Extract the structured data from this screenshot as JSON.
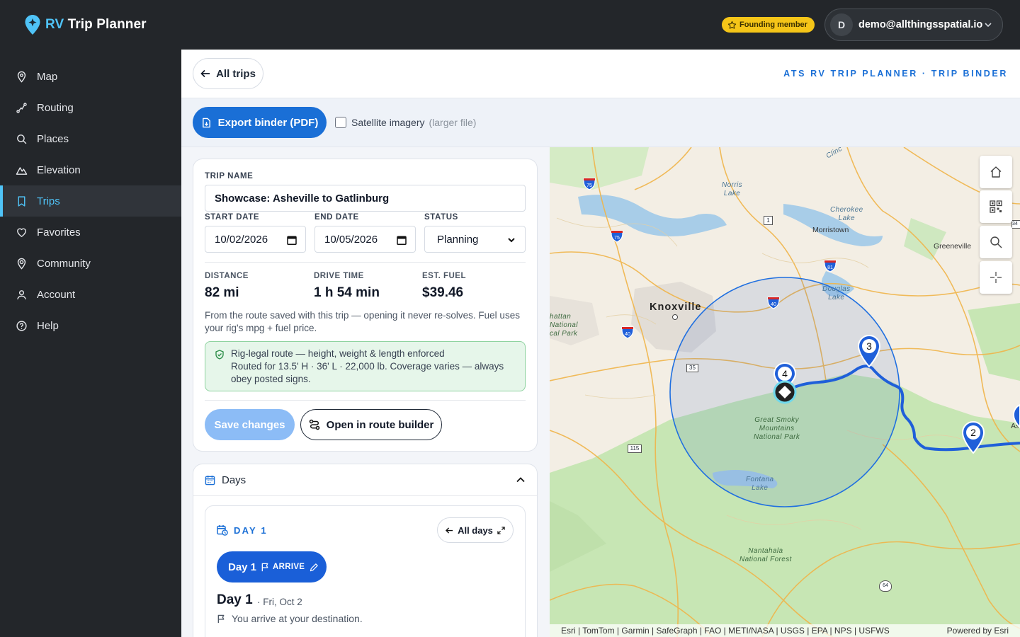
{
  "app": {
    "brand_rv": "RV",
    "brand_rest": " Trip Planner",
    "founding": "Founding member",
    "avatar_letter": "D",
    "email": "demo@allthingsspatial.io"
  },
  "sidebar": {
    "items": [
      {
        "label": "Map",
        "icon": "map-pin-icon"
      },
      {
        "label": "Routing",
        "icon": "route-icon"
      },
      {
        "label": "Places",
        "icon": "search-icon"
      },
      {
        "label": "Elevation",
        "icon": "mountain-icon"
      },
      {
        "label": "Trips",
        "icon": "bookmark-icon",
        "active": true
      },
      {
        "label": "Favorites",
        "icon": "heart-icon"
      },
      {
        "label": "Community",
        "icon": "community-pin-icon"
      },
      {
        "label": "Account",
        "icon": "user-icon"
      },
      {
        "label": "Help",
        "icon": "help-icon"
      }
    ]
  },
  "header": {
    "back_label": "All trips",
    "binder_title": "ATS RV TRIP PLANNER · TRIP BINDER"
  },
  "toolbar": {
    "export_label": "Export binder (PDF)",
    "satellite_label": "Satellite imagery",
    "satellite_hint": "(larger file)",
    "satellite_checked": false
  },
  "trip": {
    "name_label": "TRIP NAME",
    "name": "Showcase: Asheville to Gatlinburg",
    "start_label": "START DATE",
    "start": "10/02/2026",
    "end_label": "END DATE",
    "end": "10/05/2026",
    "status_label": "STATUS",
    "status": "Planning",
    "distance_label": "DISTANCE",
    "distance": "82 mi",
    "drive_label": "DRIVE TIME",
    "drive": "1 h 54 min",
    "fuel_label": "EST. FUEL",
    "fuel": "$39.46",
    "note": "From the route saved with this trip — opening it never re-solves. Fuel uses your rig's mpg + fuel price.",
    "legal_title": "Rig-legal route — height, weight & length enforced",
    "legal_detail": "Routed for 13.5' H · 36' L · 22,000 lb. Coverage varies — always obey posted signs.",
    "save_label": "Save changes",
    "builder_label": "Open in route builder"
  },
  "days": {
    "title": "Days",
    "day_tag": "DAY 1",
    "all_days": "All days",
    "pill_day": "Day 1",
    "pill_arrive": "ARRIVE",
    "day_title": "Day 1",
    "day_date": "· Fri, Oct 2",
    "arrive_text": "You arrive at your destination."
  },
  "map": {
    "cities": {
      "knoxville": "Knoxville",
      "morristown": "Morristown",
      "greeneville": "Greeneville",
      "as": "As"
    },
    "features": {
      "norris": "Norris\nLake",
      "cherokee": "Cherokee\nLake",
      "douglas": "Douglas\nLake",
      "smoky": "Great Smoky\nMountains\nNational Park",
      "fontana": "Fontana\nLake",
      "nantahala": "Nantahala\nNational Forest",
      "manhattan": "hattan\nNational\ncal Park",
      "clinch": "Clinc"
    },
    "shields": [
      "75",
      "75",
      "40",
      "40",
      "81",
      "1",
      "35",
      "115",
      "64",
      "34"
    ],
    "stops": [
      "4",
      "3",
      "2"
    ],
    "attribution": "Esri | TomTom | Garmin | SafeGraph | FAO | METI/NASA | USGS | EPA | NPS | USFWS",
    "powered": "Powered by Esri",
    "controls": [
      "home-icon",
      "qr-icon",
      "zoom-search-icon",
      "crosshair-icon"
    ]
  },
  "colors": {
    "accent": "#1a6fd6",
    "sidebar_bg": "#23262a",
    "active": "#4fc3f7",
    "route": "#1a5fd8",
    "founding": "#f5c518"
  }
}
